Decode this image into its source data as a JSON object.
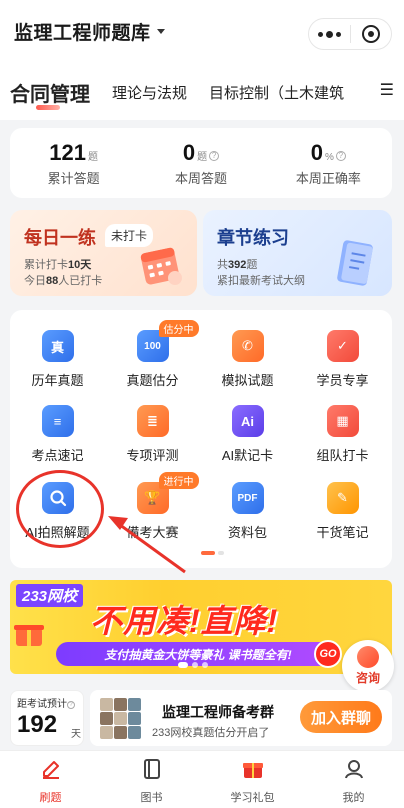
{
  "header": {
    "title": "监理工程师题库"
  },
  "tabs": [
    {
      "label": "合同管理"
    },
    {
      "label": "理论与法规"
    },
    {
      "label": "目标控制（土木建筑"
    }
  ],
  "stats": [
    {
      "value": "121",
      "unit": "题",
      "label": "累计答题"
    },
    {
      "value": "0",
      "unit": "题",
      "label": "本周答题"
    },
    {
      "value": "0",
      "unit": "%",
      "label": "本周正确率"
    }
  ],
  "daily": {
    "title": "每日一练",
    "badge": "未打卡",
    "line1_prefix": "累计打卡",
    "line1_value": "10天",
    "line2_prefix": "今日",
    "line2_value": "88",
    "line2_suffix": "人已打卡"
  },
  "chapter": {
    "title": "章节练习",
    "line1_prefix": "共",
    "line1_value": "392",
    "line1_suffix": "题",
    "line2": "紧扣最新考试大纲"
  },
  "grid": [
    {
      "label": "历年真题",
      "icon_text": "真"
    },
    {
      "label": "真题估分",
      "icon_text": "100",
      "tag": "估分中"
    },
    {
      "label": "模拟试题",
      "icon_text": ""
    },
    {
      "label": "学员专享",
      "icon_text": ""
    },
    {
      "label": "考点速记",
      "icon_text": ""
    },
    {
      "label": "专项评测",
      "icon_text": ""
    },
    {
      "label": "AI默记卡",
      "icon_text": "Ai"
    },
    {
      "label": "组队打卡",
      "icon_text": ""
    },
    {
      "label": "AI拍照解题",
      "icon_text": ""
    },
    {
      "label": "備考大赛",
      "icon_text": "",
      "tag": "进行中"
    },
    {
      "label": "资料包",
      "icon_text": "PDF"
    },
    {
      "label": "干货笔记",
      "icon_text": ""
    }
  ],
  "banner": {
    "brand": "233网校",
    "headline": "不用凑!直降!",
    "strip": "支付抽黄金大饼等豪礼 课书题全有!",
    "go": "GO"
  },
  "consult": {
    "label": "咨询"
  },
  "countdown": {
    "label": "距考试预计",
    "days": "192",
    "unit": "天"
  },
  "group": {
    "title": "监理工程师备考群",
    "subtitle": "233网校真题估分开启了",
    "join": "加入群聊"
  },
  "tabbar": [
    {
      "label": "刷题"
    },
    {
      "label": "图书"
    },
    {
      "label": "学习礼包"
    },
    {
      "label": "我的"
    }
  ],
  "colors": {
    "accent": "#e8332a",
    "daily_title": "#c0321f",
    "chapter_title": "#1c3f8f",
    "join_button": "#ff8a2a"
  }
}
